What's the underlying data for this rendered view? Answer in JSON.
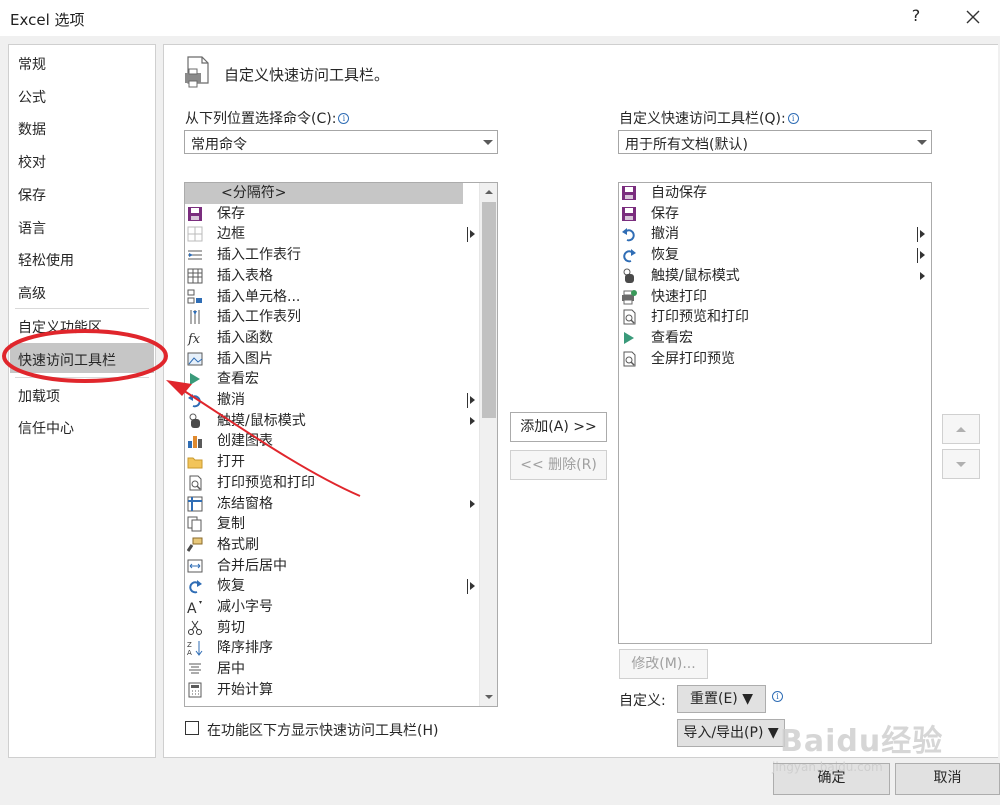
{
  "window": {
    "title": "Excel 选项",
    "help_label": "?",
    "close_icon": "close-icon"
  },
  "nav": {
    "items": [
      "常规",
      "公式",
      "数据",
      "校对",
      "保存",
      "语言",
      "轻松使用",
      "高级",
      "自定义功能区",
      "快速访问工具栏",
      "加载项",
      "信任中心"
    ],
    "selected": "快速访问工具栏"
  },
  "header": {
    "title": "自定义快速访问工具栏。"
  },
  "left": {
    "label": "从下列位置选择命令(C):",
    "dropdown_value": "常用命令",
    "items": [
      {
        "label": "<分隔符>",
        "icon": "separator"
      },
      {
        "label": "保存",
        "icon": "save-icon"
      },
      {
        "label": "边框",
        "icon": "border-icon",
        "marker": "bar"
      },
      {
        "label": "插入工作表行",
        "icon": "insert-row-icon"
      },
      {
        "label": "插入表格",
        "icon": "table-icon"
      },
      {
        "label": "插入单元格...",
        "icon": "insert-cell-icon"
      },
      {
        "label": "插入工作表列",
        "icon": "insert-column-icon"
      },
      {
        "label": "插入函数",
        "icon": "function-icon"
      },
      {
        "label": "插入图片",
        "icon": "picture-icon"
      },
      {
        "label": "查看宏",
        "icon": "macro-icon"
      },
      {
        "label": "撤消",
        "icon": "undo-icon",
        "marker": "bar"
      },
      {
        "label": "触摸/鼠标模式",
        "icon": "touch-icon",
        "marker": "arrow"
      },
      {
        "label": "创建图表",
        "icon": "chart-icon"
      },
      {
        "label": "打开",
        "icon": "open-folder-icon"
      },
      {
        "label": "打印预览和打印",
        "icon": "print-preview-icon"
      },
      {
        "label": "冻结窗格",
        "icon": "freeze-panes-icon",
        "marker": "arrow"
      },
      {
        "label": "复制",
        "icon": "copy-icon"
      },
      {
        "label": "格式刷",
        "icon": "format-painter-icon"
      },
      {
        "label": "合并后居中",
        "icon": "merge-center-icon"
      },
      {
        "label": "恢复",
        "icon": "redo-icon",
        "marker": "bar"
      },
      {
        "label": "减小字号",
        "icon": "decrease-font-icon"
      },
      {
        "label": "剪切",
        "icon": "scissors-icon"
      },
      {
        "label": "降序排序",
        "icon": "sort-desc-icon"
      },
      {
        "label": "居中",
        "icon": "align-center-icon"
      },
      {
        "label": "开始计算",
        "icon": "calculator-icon"
      }
    ],
    "checkbox_label": "在功能区下方显示快速访问工具栏(H)"
  },
  "middle": {
    "add_label": "添加(A) >>",
    "remove_label": "<< 删除(R)"
  },
  "right": {
    "label": "自定义快速访问工具栏(Q):",
    "dropdown_value": "用于所有文档(默认)",
    "items": [
      {
        "label": "自动保存",
        "icon": "autosave-icon"
      },
      {
        "label": "保存",
        "icon": "save-icon"
      },
      {
        "label": "撤消",
        "icon": "undo-icon",
        "marker": "bar"
      },
      {
        "label": "恢复",
        "icon": "redo-icon",
        "marker": "bar"
      },
      {
        "label": "触摸/鼠标模式",
        "icon": "touch-icon",
        "marker": "arrow"
      },
      {
        "label": "快速打印",
        "icon": "quick-print-icon"
      },
      {
        "label": "打印预览和打印",
        "icon": "print-preview-icon"
      },
      {
        "label": "查看宏",
        "icon": "macro-icon"
      },
      {
        "label": "全屏打印预览",
        "icon": "print-preview-icon"
      }
    ],
    "modify_label": "修改(M)...",
    "customize_label": "自定义:",
    "reset_label": "重置(E) ▼",
    "import_export_label": "导入/导出(P) ▼"
  },
  "footer": {
    "ok_label": "确定",
    "cancel_label": "取消"
  },
  "watermark": {
    "text": "Baidu经验",
    "url_text": "jingyan.baidu.com"
  },
  "colors": {
    "annotation_red": "#e0262c",
    "selected_nav": "#c6c6c6",
    "accent_blue": "#2f6db5",
    "save_purple": "#7a2d7e"
  }
}
